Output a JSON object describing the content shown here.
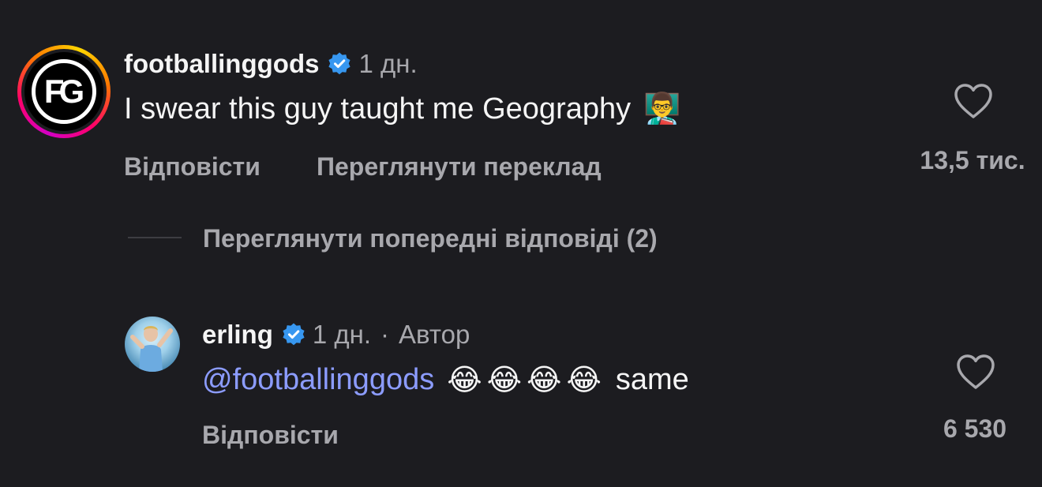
{
  "comment": {
    "avatar_initials": "FG",
    "username": "footballinggods",
    "time": "1 дн.",
    "text": "I swear this guy taught me Geography",
    "emoji": "👨‍🏫",
    "reply_label": "Відповісти",
    "translate_label": "Переглянути переклад",
    "likes": "13,5 тис."
  },
  "view_previous": "Переглянути попередні відповіді (2)",
  "reply": {
    "username": "erling",
    "time": "1 дн.",
    "separator": "·",
    "author_label": "Автор",
    "mention": "@footballinggods",
    "emojis": "😂😂😂😂",
    "text": "same",
    "reply_label": "Відповісти",
    "likes": "6 530"
  },
  "colors": {
    "background": "#1c1c20",
    "verified": "#3797f0",
    "mention": "#8c9cff",
    "secondary_text": "#a8a8ad"
  },
  "icons": {
    "verified": "verified-badge-icon",
    "like": "heart-outline-icon"
  }
}
